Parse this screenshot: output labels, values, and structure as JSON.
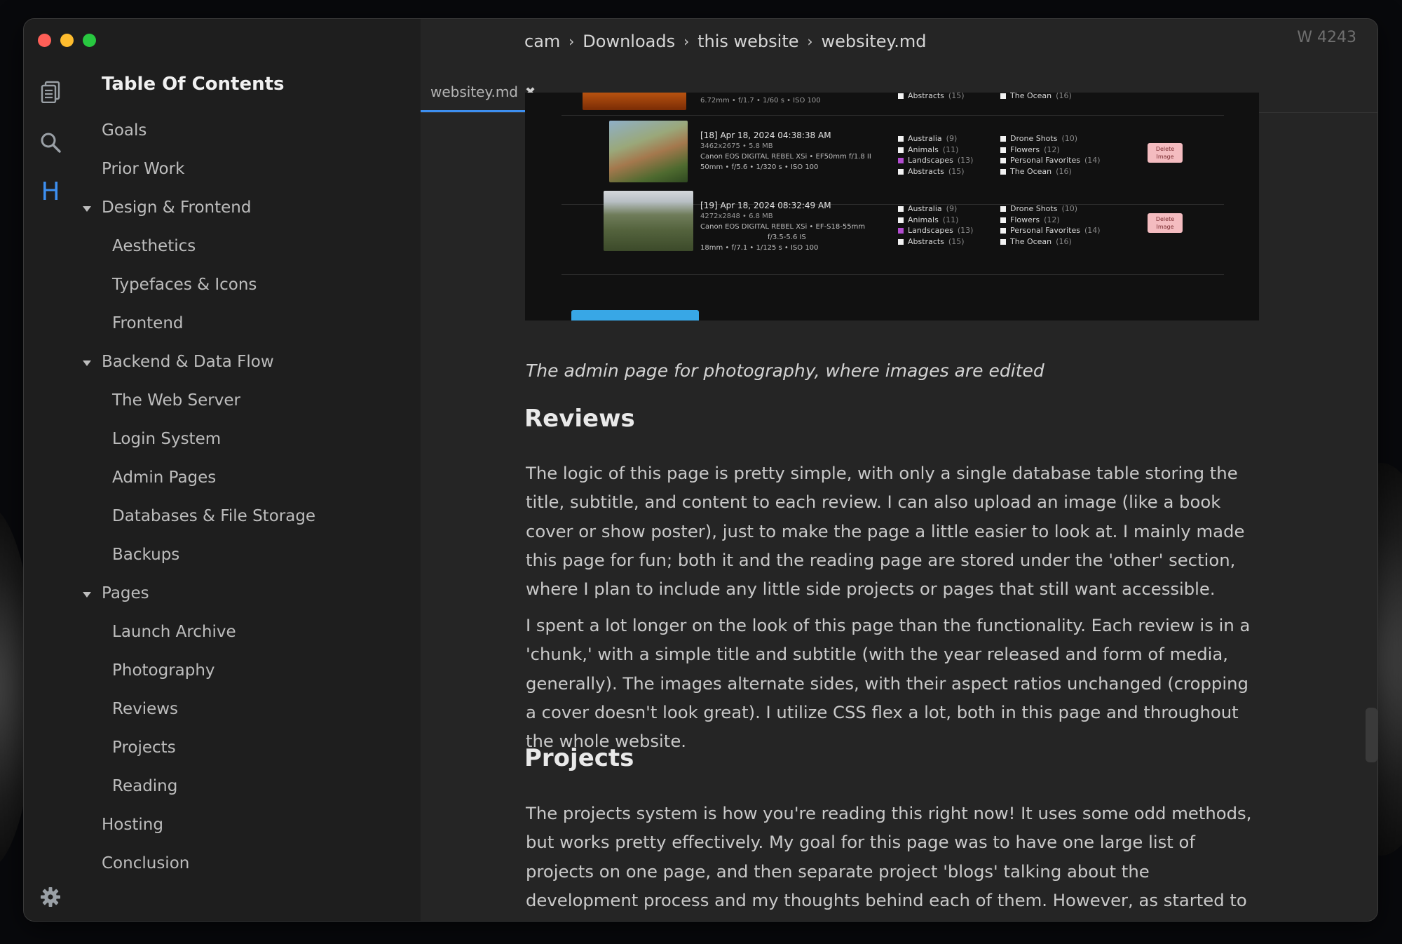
{
  "window": {
    "wordcount": "W 4243"
  },
  "breadcrumb": [
    "cam",
    "Downloads",
    "this website",
    "websitey.md"
  ],
  "tab": {
    "label": "websitey.md",
    "close_glyph": "✖"
  },
  "rail": {
    "icons": [
      "files-icon",
      "search-icon",
      "heading-icon",
      "gear-icon"
    ],
    "heading_glyph": "H",
    "accent": "#3d8ff0"
  },
  "toc": {
    "title": "Table Of Contents",
    "items": [
      {
        "label": "Goals",
        "level": 1,
        "expanded": null
      },
      {
        "label": "Prior Work",
        "level": 1,
        "expanded": null
      },
      {
        "label": "Design & Frontend",
        "level": 1,
        "expanded": true
      },
      {
        "label": "Aesthetics",
        "level": 2,
        "expanded": null
      },
      {
        "label": "Typefaces & Icons",
        "level": 2,
        "expanded": null
      },
      {
        "label": "Frontend",
        "level": 2,
        "expanded": null
      },
      {
        "label": "Backend & Data Flow",
        "level": 1,
        "expanded": true
      },
      {
        "label": "The Web Server",
        "level": 2,
        "expanded": null
      },
      {
        "label": "Login System",
        "level": 2,
        "expanded": null
      },
      {
        "label": "Admin Pages",
        "level": 2,
        "expanded": null
      },
      {
        "label": "Databases & File Storage",
        "level": 2,
        "expanded": null
      },
      {
        "label": "Backups",
        "level": 2,
        "expanded": null
      },
      {
        "label": "Pages",
        "level": 1,
        "expanded": true
      },
      {
        "label": "Launch Archive",
        "level": 2,
        "expanded": null
      },
      {
        "label": "Photography",
        "level": 2,
        "expanded": null
      },
      {
        "label": "Reviews",
        "level": 2,
        "expanded": null
      },
      {
        "label": "Projects",
        "level": 2,
        "expanded": null
      },
      {
        "label": "Reading",
        "level": 2,
        "expanded": null
      },
      {
        "label": "Hosting",
        "level": 1,
        "expanded": null
      },
      {
        "label": "Conclusion",
        "level": 1,
        "expanded": null
      }
    ]
  },
  "screenshot": {
    "top_row": {
      "meta": "6.72mm • f/1.7 • 1/60 s • ISO 100",
      "left_check": "Abstracts",
      "left_count": "(15)",
      "right_check": "The Ocean",
      "right_count": "(16)"
    },
    "rows": [
      {
        "title": "[18] Apr 18, 2024 04:38:38 AM",
        "size": "3462x2675 • 5.8 MB",
        "camera": "Canon EOS DIGITAL REBEL XSi • EF50mm f/1.8 II",
        "exposure": "50mm • f/5.6 • 1/320 s • ISO 100",
        "categories_left": [
          {
            "name": "Australia",
            "count": "(9)",
            "checked": false
          },
          {
            "name": "Animals",
            "count": "(11)",
            "checked": false
          },
          {
            "name": "Landscapes",
            "count": "(13)",
            "checked": true
          },
          {
            "name": "Abstracts",
            "count": "(15)",
            "checked": false
          }
        ],
        "categories_right": [
          {
            "name": "Drone Shots",
            "count": "(10)",
            "checked": false
          },
          {
            "name": "Flowers",
            "count": "(12)",
            "checked": false
          },
          {
            "name": "Personal Favorites",
            "count": "(14)",
            "checked": false
          },
          {
            "name": "The Ocean",
            "count": "(16)",
            "checked": false
          }
        ],
        "delete_line1": "Delete",
        "delete_line2": "Image"
      },
      {
        "title": "[19] Apr 18, 2024 08:32:49 AM",
        "size": "4272x2848 • 6.8 MB",
        "camera": "Canon EOS DIGITAL REBEL XSi • EF-S18-55mm",
        "camera2": "f/3.5-5.6 IS",
        "exposure": "18mm • f/7.1 • 1/125 s • ISO 100",
        "categories_left": [
          {
            "name": "Australia",
            "count": "(9)",
            "checked": false
          },
          {
            "name": "Animals",
            "count": "(11)",
            "checked": false
          },
          {
            "name": "Landscapes",
            "count": "(13)",
            "checked": true
          },
          {
            "name": "Abstracts",
            "count": "(15)",
            "checked": false
          }
        ],
        "categories_right": [
          {
            "name": "Drone Shots",
            "count": "(10)",
            "checked": false
          },
          {
            "name": "Flowers",
            "count": "(12)",
            "checked": false
          },
          {
            "name": "Personal Favorites",
            "count": "(14)",
            "checked": false
          },
          {
            "name": "The Ocean",
            "count": "(16)",
            "checked": false
          }
        ],
        "delete_line1": "Delete",
        "delete_line2": "Image"
      }
    ]
  },
  "document": {
    "caption": "The admin page for photography, where images are edited",
    "sections": [
      {
        "heading": "Reviews",
        "paragraphs": [
          "The logic of this page is pretty simple, with only a single database table storing the title, subtitle, and content to each review. I can also upload an image (like a book cover or show poster), just to make the page a little easier to look at. I mainly made this page for fun; both it and the reading page are stored under the 'other' section, where I plan to include any little side projects or pages that still want accessible.",
          "I spent a lot longer on the look of this page than the functionality. Each review is in a 'chunk,' with a simple title and subtitle (with the year released and form of media, generally). The images alternate sides, with their aspect ratios unchanged (cropping a cover doesn't look great). I utilize CSS flex a lot, both in this page and throughout the whole website."
        ]
      },
      {
        "heading": "Projects",
        "paragraphs": [
          "The projects system is how you're reading this right now! It uses some odd methods, but works pretty effectively. My goal for this page was to have one large list of projects on one page, and then separate project 'blogs' talking about the development process and my thoughts behind each of them. However, as started to add the first few projects, I realized I would need to add a few new features. Mainly, the ability to customize the links for each"
        ]
      }
    ]
  }
}
